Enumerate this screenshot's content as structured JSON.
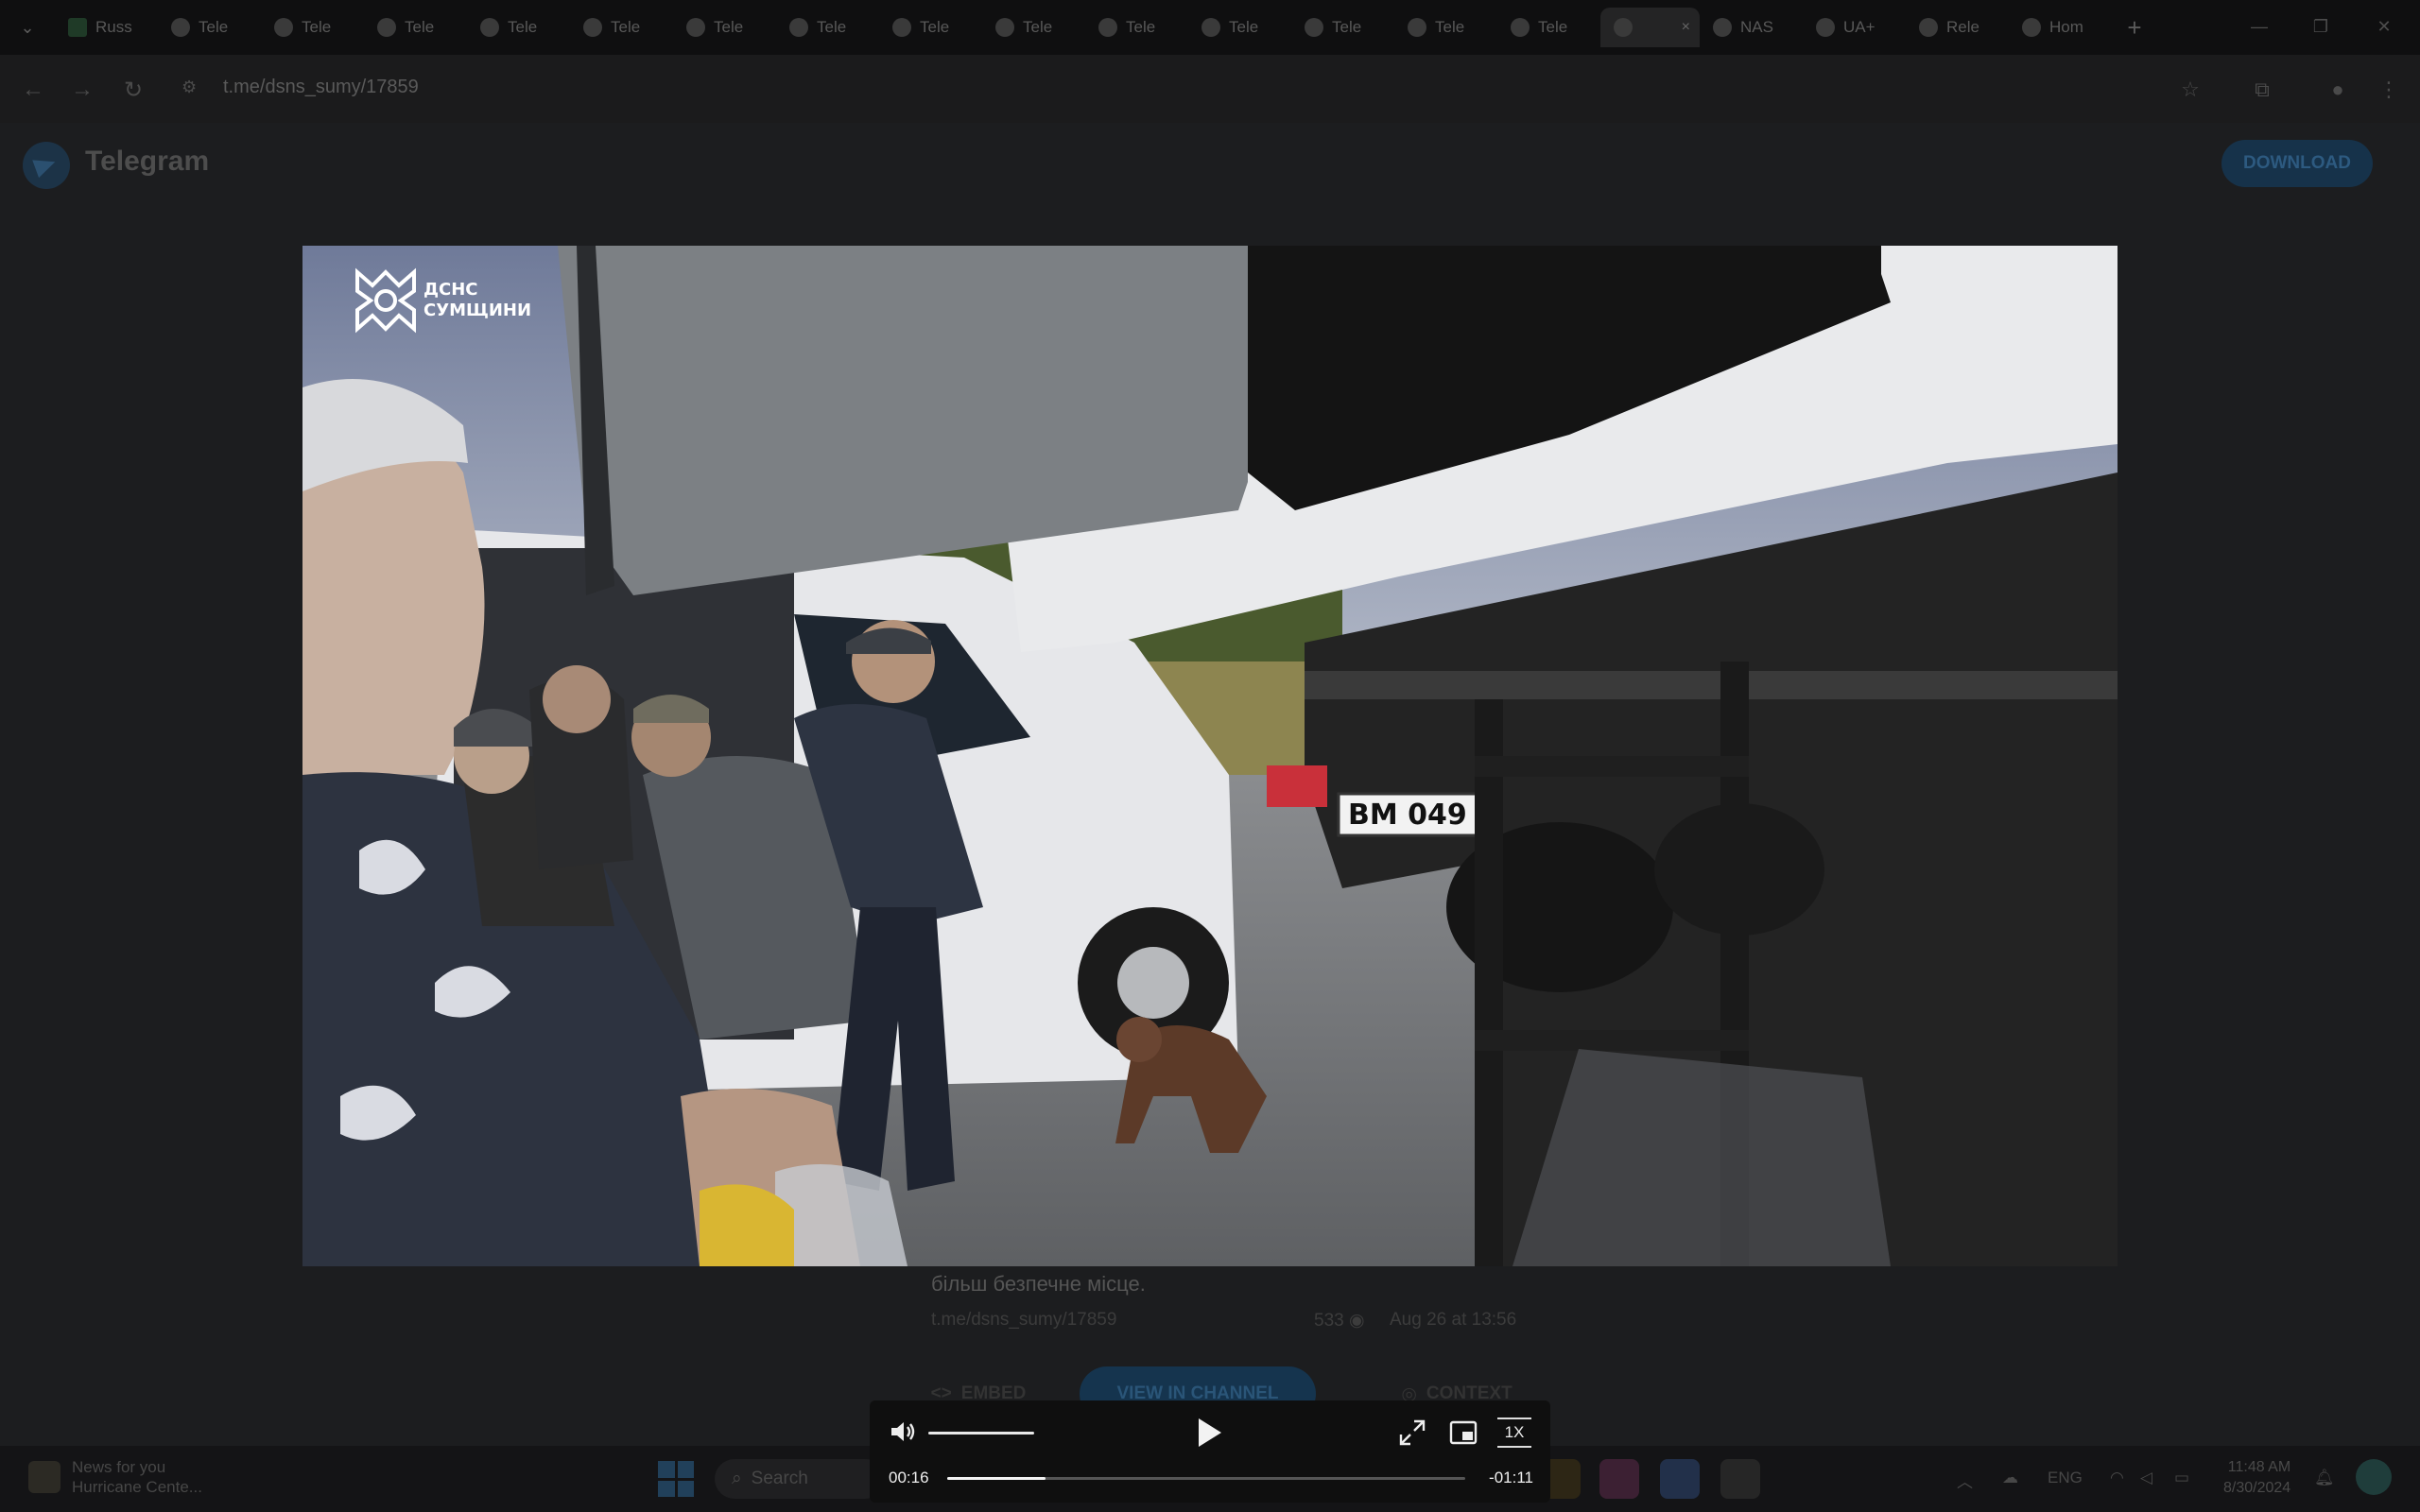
{
  "browser": {
    "tabs": [
      {
        "label": "Russ",
        "icon": "sheets-icon"
      },
      {
        "label": "Tele",
        "icon": "globe-icon"
      },
      {
        "label": "Tele",
        "icon": "globe-icon"
      },
      {
        "label": "Tele",
        "icon": "globe-icon"
      },
      {
        "label": "Tele",
        "icon": "globe-icon"
      },
      {
        "label": "Tele",
        "icon": "globe-icon"
      },
      {
        "label": "Tele",
        "icon": "globe-icon"
      },
      {
        "label": "Tele",
        "icon": "globe-icon"
      },
      {
        "label": "Tele",
        "icon": "globe-icon"
      },
      {
        "label": "Tele",
        "icon": "globe-icon"
      },
      {
        "label": "Tele",
        "icon": "globe-icon"
      },
      {
        "label": "Tele",
        "icon": "globe-icon"
      },
      {
        "label": "Tele",
        "icon": "globe-icon"
      },
      {
        "label": "Tele",
        "icon": "globe-icon"
      },
      {
        "label": "Tele",
        "icon": "globe-icon"
      }
    ],
    "active_tab_close": "×",
    "extra_tabs": [
      {
        "label": "NAS",
        "icon": "nas-icon"
      },
      {
        "label": "UA+",
        "icon": "ua-icon"
      },
      {
        "label": "Rele",
        "icon": "chat-icon"
      },
      {
        "label": "Hom",
        "icon": "home-icon"
      }
    ],
    "new_tab": "+",
    "url": "t.me/dsns_sumy/17859"
  },
  "telegram": {
    "title": "Telegram",
    "download_label": "DOWNLOAD",
    "post_text": "більш безпечне місце.",
    "post_link": "t.me/dsns_sumy/17859",
    "views": "533",
    "date": "Aug 26 at 13:56",
    "embed_label": "EMBED",
    "view_in_channel_label": "VIEW IN CHANNEL",
    "context_label": "CONTEXT"
  },
  "video": {
    "watermark_line1": "ДСНС",
    "watermark_line2": "СУМЩИНИ",
    "plate_text": "BM 049",
    "current_time": "00:16",
    "remaining_time": "-01:11",
    "speed_label": "1X",
    "progress_fraction": 0.19
  },
  "taskbar": {
    "news_title": "News for you",
    "news_subtitle": "Hurricane Cente...",
    "search_label": "Search",
    "lang": "ENG",
    "time": "11:48 AM",
    "date": "8/30/2024"
  }
}
